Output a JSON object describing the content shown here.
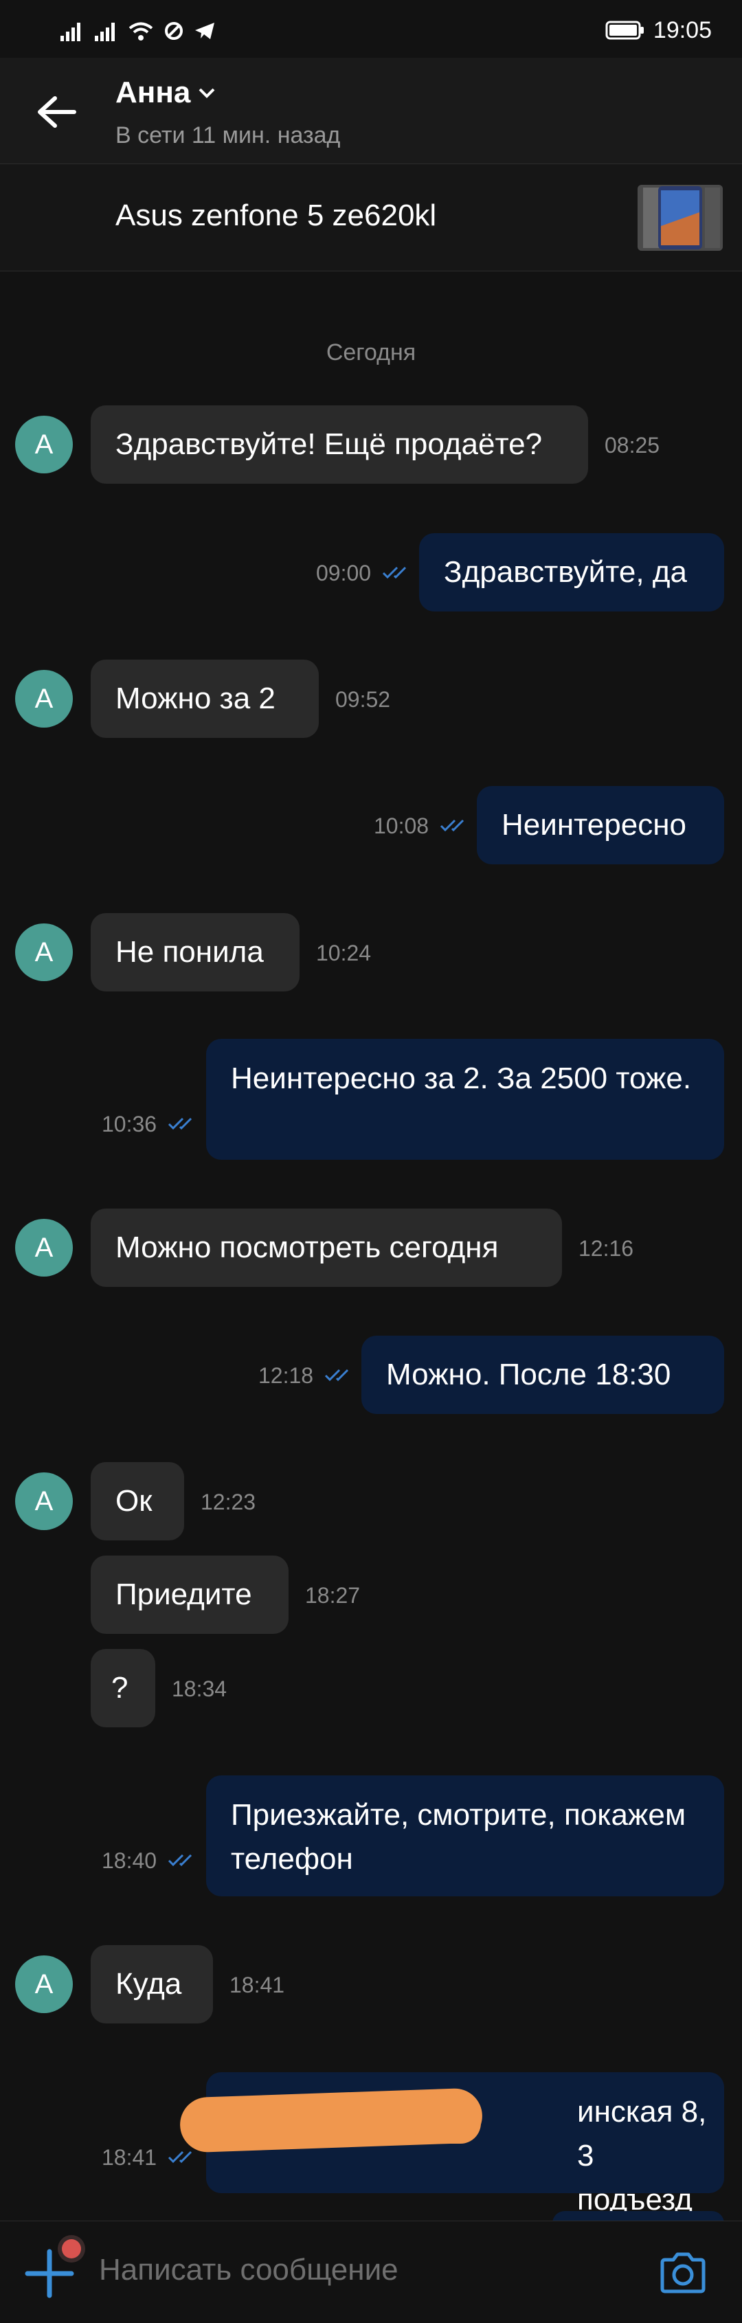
{
  "status_bar": {
    "time": "19:05"
  },
  "header": {
    "name": "Анна",
    "status": "В сети 11 мин. назад"
  },
  "product": {
    "title": "Asus zenfone 5 ze620kl"
  },
  "date_separator": "Сегодня",
  "avatar_letter": "А",
  "messages": [
    {
      "dir": "in",
      "text": "Здравствуйте! Ещё продаёте?",
      "time": "08:25"
    },
    {
      "dir": "out",
      "text": "Здравствуйте, да",
      "time": "09:00"
    },
    {
      "dir": "in",
      "text": "Можно за 2",
      "time": "09:52"
    },
    {
      "dir": "out",
      "text": "Неинтересно",
      "time": "10:08"
    },
    {
      "dir": "in",
      "text": "Не понила",
      "time": "10:24"
    },
    {
      "dir": "out",
      "text": "Неинтересно за 2. За 2500 тоже.",
      "time": "10:36"
    },
    {
      "dir": "in",
      "text": "Можно посмотреть сегодня",
      "time": "12:16"
    },
    {
      "dir": "out",
      "text": "Можно. После 18:30",
      "time": "12:18"
    },
    {
      "dir": "in",
      "text": "Ок",
      "time": "12:23"
    },
    {
      "dir": "in",
      "text": "Приедите",
      "time": "18:27"
    },
    {
      "dir": "in",
      "text": "?",
      "time": "18:34"
    },
    {
      "dir": "out",
      "text": "Приезжайте, смотрите, покажем телефон",
      "time": "18:40"
    },
    {
      "dir": "in",
      "text": "Куда",
      "time": "18:41"
    },
    {
      "dir": "out",
      "text": "инская 8, 3 подъезд",
      "time": "18:41"
    }
  ],
  "composer": {
    "placeholder": "Написать сообщение"
  },
  "colors": {
    "background": "#121212",
    "incoming_bubble": "#2a2a2a",
    "outgoing_bubble": "#0b1d3b",
    "avatar": "#4a9d92",
    "accent": "#3a8fd9",
    "read_checks": "#3a7fd0",
    "redaction": "#f0974e"
  },
  "icons": [
    "back-arrow-icon",
    "chevron-down-icon",
    "plus-icon",
    "camera-icon",
    "double-check-icon",
    "signal-icon",
    "wifi-icon",
    "battery-icon",
    "telegram-icon"
  ]
}
